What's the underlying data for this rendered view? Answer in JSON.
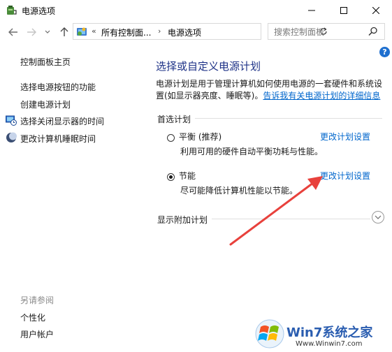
{
  "window": {
    "title": "电源选项",
    "controls": {
      "minimize": "minimize",
      "maximize": "maximize",
      "close": "close"
    }
  },
  "address_bar": {
    "overflow": "«",
    "crumbs": [
      "所有控制面...",
      "电源选项"
    ],
    "separator": "›"
  },
  "search": {
    "placeholder": "搜索控制面板",
    "value": ""
  },
  "left_pane": {
    "home": "控制面板主页",
    "links": [
      "选择电源按钮的功能",
      "创建电源计划",
      "选择关闭显示器的时间",
      "更改计算机睡眠时间"
    ],
    "see_also": {
      "title": "另请参阅",
      "links": [
        "个性化",
        "用户帐户"
      ]
    }
  },
  "main": {
    "help_label": "?",
    "title": "选择或自定义电源计划",
    "description_line1": "电源计划是用于管理计算机如何使用电源的一套硬件和系统设",
    "description_line2": "置(如显示器亮度、睡眠等)。",
    "description_link": "告诉我有关电源计划的详细信息",
    "preferred_title": "首选计划",
    "plans": [
      {
        "name": "平衡 (推荐)",
        "description": "利用可用的硬件自动平衡功耗与性能。",
        "link": "更改计划设置",
        "selected": false
      },
      {
        "name": "节能",
        "description": "尽可能降低计算机性能以节能。",
        "link": "更改计划设置",
        "selected": true
      }
    ],
    "additional_title": "显示附加计划"
  },
  "annotation": {
    "arrow_color": "#e8413c"
  },
  "watermark": {
    "text": "Win7系统之家",
    "url": "Www.Winwin7.com"
  },
  "colors": {
    "title_blue": "#1e3287",
    "link_blue": "#0066cc"
  }
}
